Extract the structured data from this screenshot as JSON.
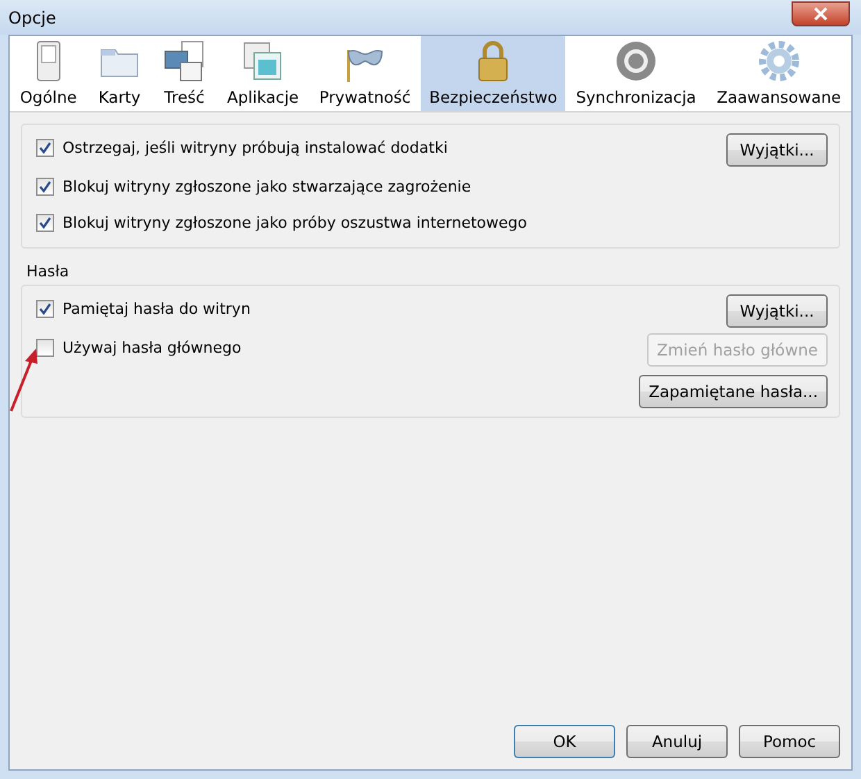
{
  "window": {
    "title": "Opcje"
  },
  "tabs": [
    {
      "label": "Ogólne",
      "selected": false
    },
    {
      "label": "Karty",
      "selected": false
    },
    {
      "label": "Treść",
      "selected": false
    },
    {
      "label": "Aplikacje",
      "selected": false
    },
    {
      "label": "Prywatność",
      "selected": false
    },
    {
      "label": "Bezpieczeństwo",
      "selected": true
    },
    {
      "label": "Synchronizacja",
      "selected": false
    },
    {
      "label": "Zaawansowane",
      "selected": false
    }
  ],
  "groups": [
    {
      "rows": [
        {
          "label": "Ostrzegaj, jeśli witryny próbują instalować dodatki",
          "checked": true,
          "buttons": [
            {
              "label": "Wyjątki...",
              "disabled": false
            }
          ]
        },
        {
          "label": "Blokuj witryny zgłoszone jako stwarzające zagrożenie",
          "checked": true
        },
        {
          "label": "Blokuj witryny zgłoszone jako próby oszustwa internetowego",
          "checked": true
        }
      ]
    },
    {
      "title": "Hasła",
      "rows": [
        {
          "label": "Pamiętaj hasła do witryn",
          "checked": true,
          "buttons": [
            {
              "label": "Wyjątki...",
              "disabled": false
            }
          ]
        },
        {
          "label": "Używaj hasła głównego",
          "checked": false,
          "buttons": [
            {
              "label": "Zmień hasło główne",
              "disabled": true
            },
            {
              "label": "Zapamiętane hasła...",
              "disabled": false
            }
          ]
        }
      ]
    }
  ],
  "footer_buttons": [
    {
      "label": "OK",
      "default": true
    },
    {
      "label": "Anuluj",
      "default": false
    },
    {
      "label": "Pomoc",
      "default": false
    }
  ]
}
